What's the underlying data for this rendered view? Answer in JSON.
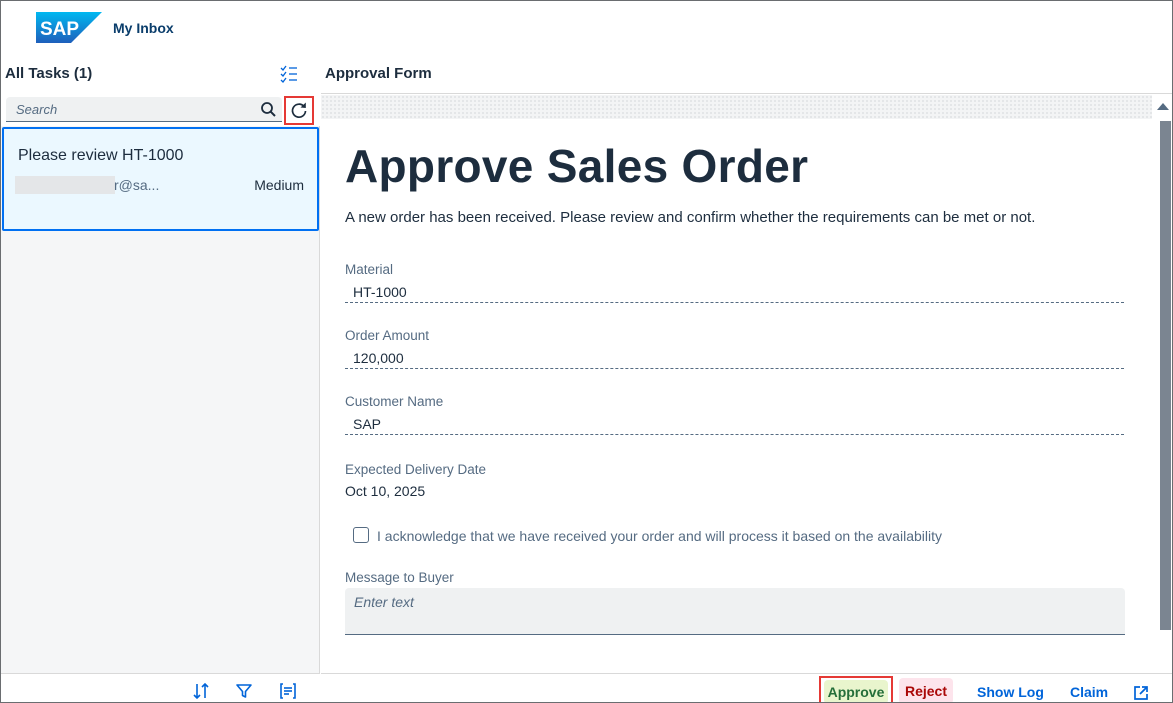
{
  "shell": {
    "logo_text": "SAP",
    "app_title": "My Inbox"
  },
  "master": {
    "title": "All Tasks (1)",
    "search_placeholder": "Search",
    "tasks": [
      {
        "title": "Please review HT-1000",
        "from": "r@sa...",
        "priority": "Medium"
      }
    ]
  },
  "detail": {
    "title": "Approval Form",
    "form": {
      "heading": "Approve Sales Order",
      "description": "A new order has been received. Please review and confirm whether the requirements can be met or not.",
      "fields": [
        {
          "label": "Material",
          "value": "HT-1000"
        },
        {
          "label": "Order Amount",
          "value": "120,000"
        },
        {
          "label": "Customer Name",
          "value": "SAP"
        },
        {
          "label": "Expected Delivery Date",
          "value": "Oct 10, 2025"
        }
      ],
      "checkbox_label": "I acknowledge that we have received your order and will process it based on the availability",
      "checkbox_checked": false,
      "message_label": "Message to Buyer",
      "message_placeholder": "Enter text"
    },
    "footer": {
      "approve": "Approve",
      "reject": "Reject",
      "show_log": "Show Log",
      "claim": "Claim"
    }
  },
  "colors": {
    "brand": "#0a3d6b",
    "accent": "#0070f2",
    "highlight_border": "#e53935",
    "positive": "#256f3a",
    "negative": "#aa0808"
  }
}
